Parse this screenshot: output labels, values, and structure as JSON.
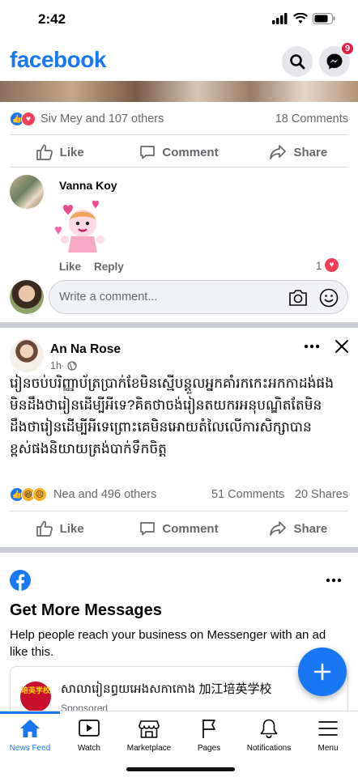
{
  "status_bar": {
    "time": "2:42"
  },
  "app_bar": {
    "logo": "facebook",
    "messenger_badge": "9"
  },
  "post1": {
    "reaction_summary": "Siv Mey and 107 others",
    "comments_count": "18 Comments"
  },
  "actions": {
    "like": "Like",
    "comment": "Comment",
    "share": "Share"
  },
  "comment": {
    "author": "Vanna Koy",
    "like": "Like",
    "reply": "Reply",
    "reaction_count": "1"
  },
  "comment_input": {
    "placeholder": "Write a comment..."
  },
  "post2": {
    "author": "An Na Rose",
    "time": "1h",
    "text": "រៀនចប់បរិញ្ញាប័ត្រប្រាក់ខែមិនស្មើបន្តួលអ្នកគាំរកកេះអកកាដង់ផង មិនដឹងថារៀនដើម្បីអីទេ?គិតថាចង់រៀនតយករអនុបណ្ឌិតតែមិនដឹងថារៀនដើម្បីអីទេព្រោះគេមិនអោយតំលៃលើការសិក្សាបានខ្ពស់ផងនិយាយត្រង់បាក់ទឹកចិត្ត",
    "reaction_summary": "Nea and 496 others",
    "comments_count": "51 Comments",
    "shares_count": "20 Shares"
  },
  "ad": {
    "title": "Get More Messages",
    "body": "Help people reach your business on Messenger with an ad like this.",
    "page_name": "សាលារៀនព្ធយអេងសកាកោង 加江培英学校",
    "sponsored": "Sponsored",
    "logo_text": "培英学校"
  },
  "bottom_nav": {
    "items": [
      "News Feed",
      "Watch",
      "Marketplace",
      "Pages",
      "Notifications",
      "Menu"
    ]
  },
  "colors": {
    "brand": "#1877f2",
    "love": "#f33e58",
    "badge": "#e41e3f"
  }
}
